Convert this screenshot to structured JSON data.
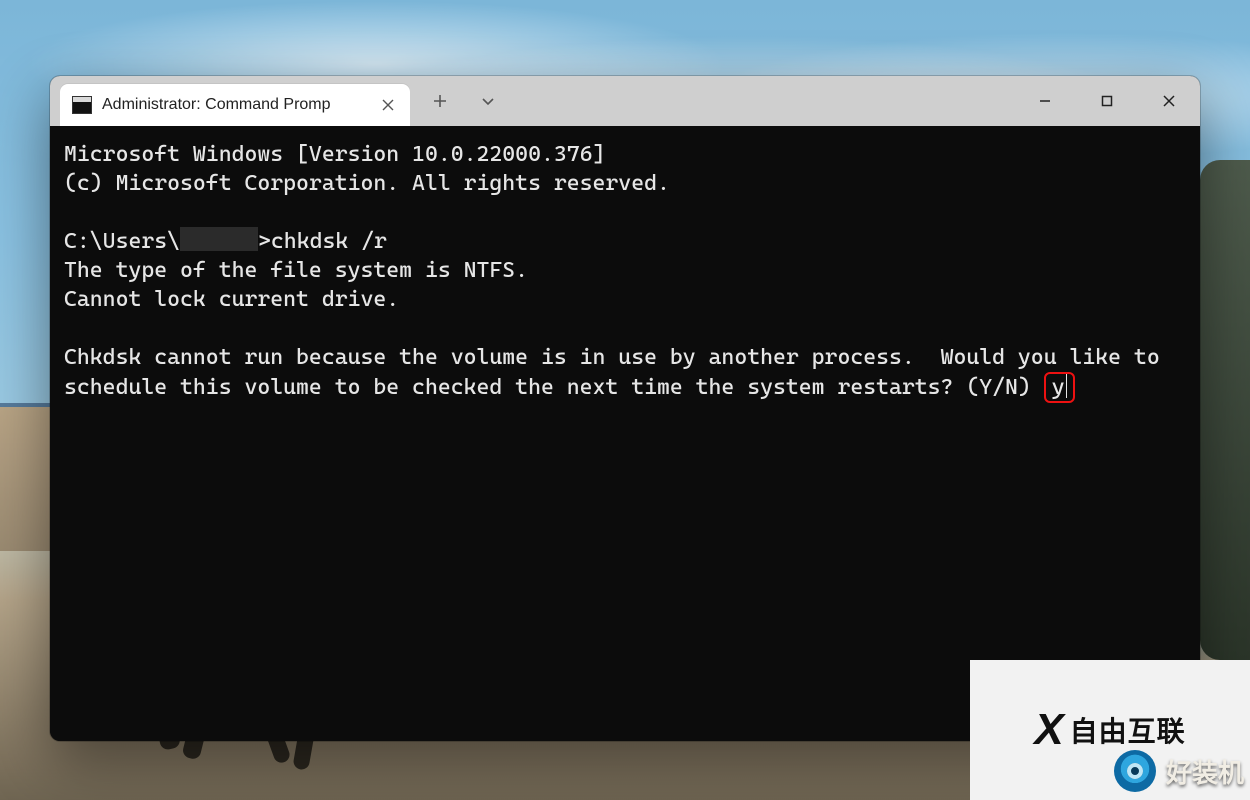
{
  "window": {
    "tab_title": "Administrator: Command Promp",
    "icon_name": "cmd-icon"
  },
  "terminal": {
    "banner_line1": "Microsoft Windows [Version 10.0.22000.376]",
    "banner_line2": "(c) Microsoft Corporation. All rights reserved.",
    "prompt_prefix": "C:\\Users\\",
    "prompt_user_redacted": true,
    "prompt_suffix": ">",
    "command": "chkdsk /r",
    "out_line1": "The type of the file system is NTFS.",
    "out_line2": "Cannot lock current drive.",
    "out_msg": "Chkdsk cannot run because the volume is in use by another process.  Would you like to schedule this volume to be checked the next time the system restarts? (Y/N) ",
    "answer": "y"
  },
  "watermarks": {
    "box_text": "自由互联",
    "strip_text": "好装机"
  }
}
